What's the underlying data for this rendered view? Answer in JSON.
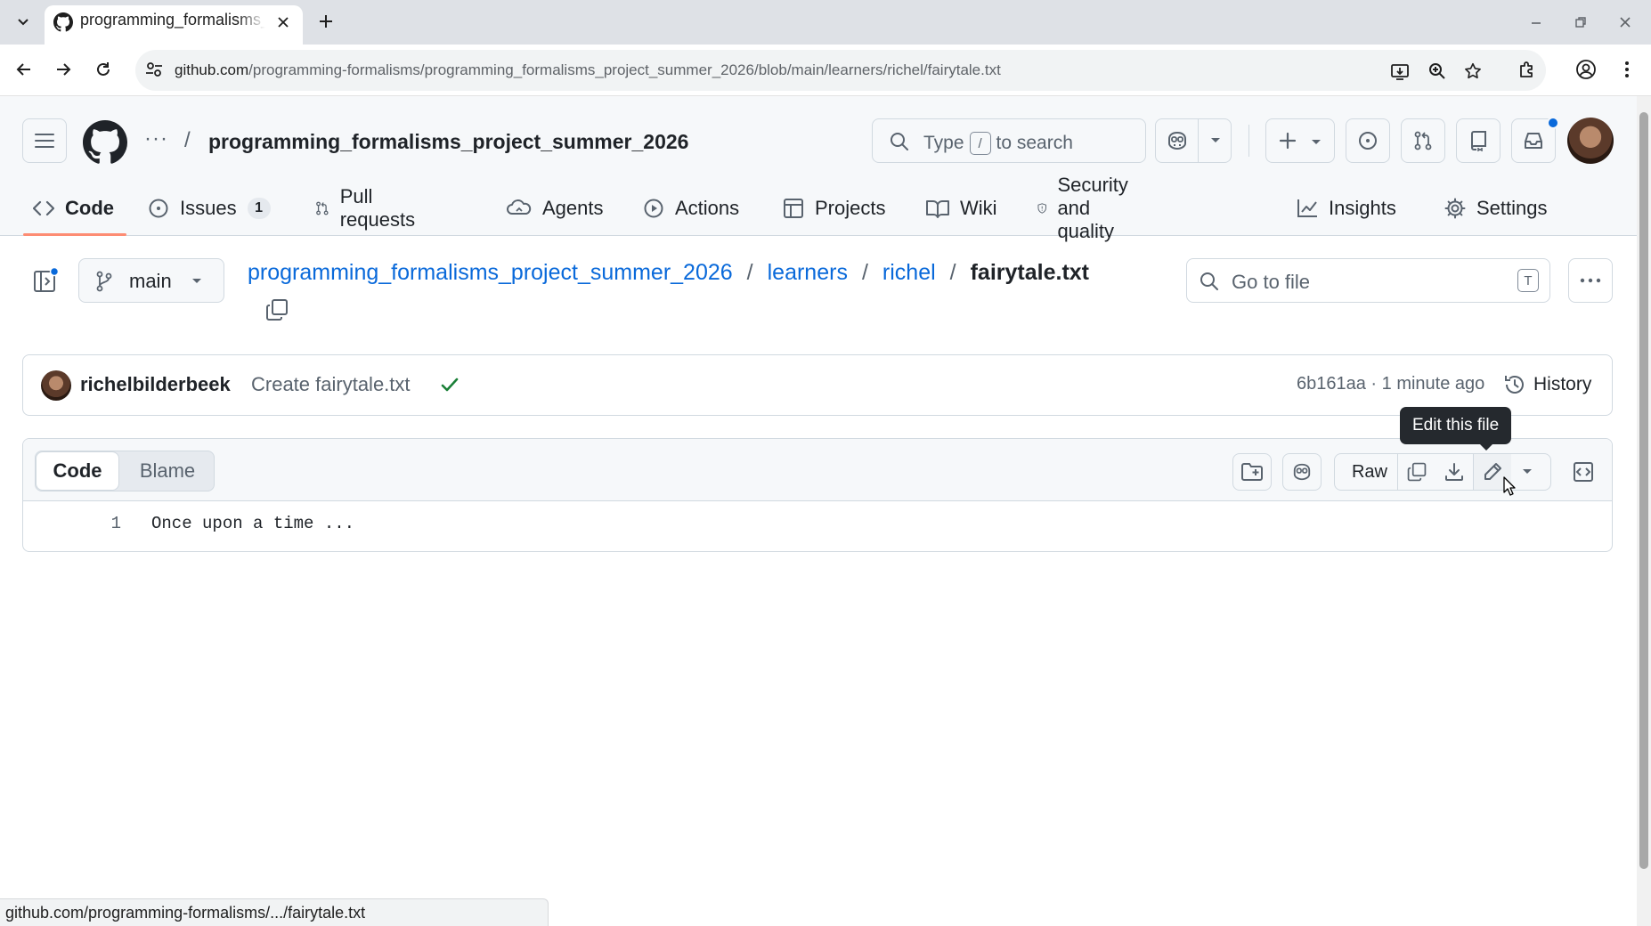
{
  "browser": {
    "tab_title": "programming_formalisms_project_summer_2026",
    "url_domain": "github.com",
    "url_path": "/programming-formalisms/programming_formalisms_project_summer_2026/blob/main/learners/richel/fairytale.txt",
    "status_url": "github.com/programming-formalisms/.../fairytale.txt"
  },
  "header": {
    "ellipsis": "···",
    "slash": "/",
    "repo_name": "programming_formalisms_project_summer_2026",
    "search_prefix": "Type",
    "search_key": "/",
    "search_suffix": "to search"
  },
  "repo_nav": {
    "code": "Code",
    "issues": "Issues",
    "issues_count": "1",
    "pull_requests": "Pull requests",
    "agents": "Agents",
    "actions": "Actions",
    "projects": "Projects",
    "wiki": "Wiki",
    "security": "Security and quality",
    "insights": "Insights",
    "settings": "Settings"
  },
  "file_nav": {
    "branch": "main",
    "breadcrumb": [
      "programming_formalisms_project_summer_2026",
      "learners",
      "richel"
    ],
    "separator": "/",
    "file_name": "fairytale.txt",
    "goto_placeholder": "Go to file",
    "goto_key": "T"
  },
  "commit": {
    "author": "richelbilderbeek",
    "message": "Create fairytale.txt",
    "meta": "6b161aa · 1 minute ago",
    "history": "History"
  },
  "viewer": {
    "tab_code": "Code",
    "tab_blame": "Blame",
    "raw": "Raw",
    "tooltip": "Edit this file",
    "lines": [
      {
        "number": "1",
        "text": "Once upon a time ..."
      }
    ]
  },
  "colors": {
    "link": "#0969da",
    "accent_underline": "#fd8c73",
    "success": "#1a7f37",
    "border": "#d1d9e0"
  }
}
